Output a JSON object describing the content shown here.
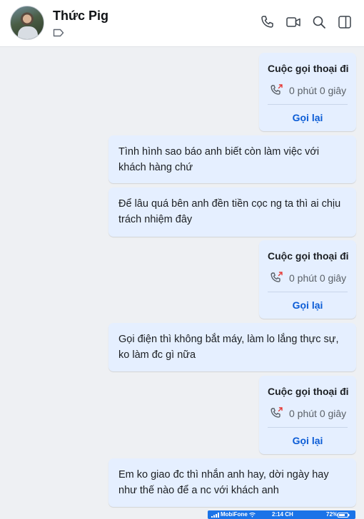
{
  "header": {
    "contact_name": "Thức Pig",
    "icons": [
      "tag-icon",
      "phone-icon",
      "video-icon",
      "search-icon",
      "sidebar-toggle-icon"
    ]
  },
  "call_card": {
    "title": "Cuộc gọi thoại đi",
    "duration": "0 phút 0 giây",
    "callback": "Gọi lại",
    "icon": "outgoing-call-icon"
  },
  "messages": [
    {
      "type": "call"
    },
    {
      "type": "text",
      "text": "Tình hình sao báo anh biết còn làm việc với khách hàng chứ"
    },
    {
      "type": "text",
      "text": "Để lâu quá bên anh đền tiền cọc ng ta thì ai chịu trách nhiệm đây"
    },
    {
      "type": "call"
    },
    {
      "type": "text",
      "text": "Gọi điện thì không bắt máy, làm lo lắng thực sự, ko làm đc gì nữa"
    },
    {
      "type": "call"
    },
    {
      "type": "text",
      "text": "Em ko giao đc thì nhắn anh hay, dời ngày hay như thế nào để a nc với khách anh"
    }
  ],
  "status_bar": {
    "carrier": "MobiFone",
    "time": "2:14 CH",
    "battery": "72%"
  },
  "colors": {
    "bubble": "#e5efff",
    "background": "#eef0f3",
    "link": "#0b5cd6",
    "missed_arrow": "#e53935"
  }
}
